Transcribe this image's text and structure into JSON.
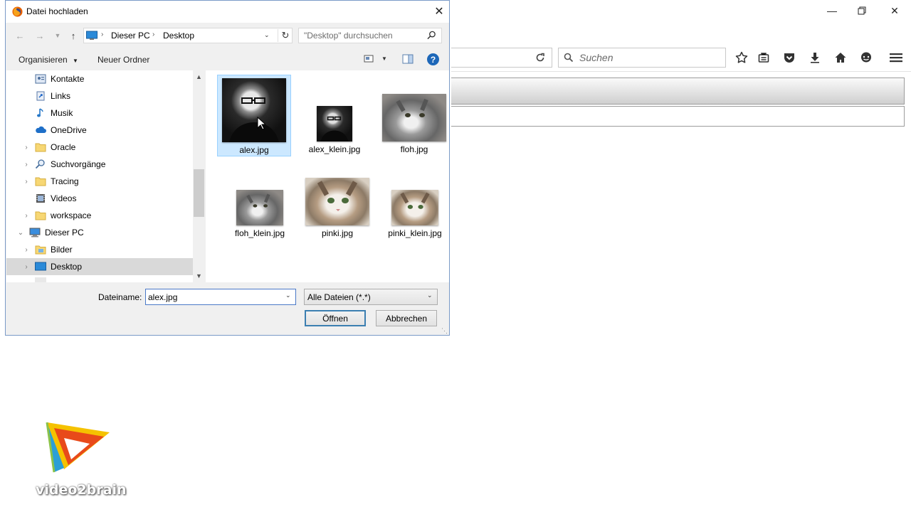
{
  "browser": {
    "search_placeholder": "Suchen",
    "window_controls": [
      "minimize-icon",
      "restore-icon",
      "close-icon"
    ],
    "toolbar_icons": [
      "reload-icon",
      "search-icon",
      "bookmark-star-icon",
      "reading-list-icon",
      "pocket-icon",
      "download-icon",
      "home-icon",
      "chat-icon",
      "menu-icon"
    ]
  },
  "dialog": {
    "title": "Datei hochladen",
    "breadcrumb": [
      "Dieser PC",
      "Desktop"
    ],
    "search_placeholder": "\"Desktop\" durchsuchen",
    "commands": {
      "organize": "Organisieren",
      "new_folder": "Neuer Ordner"
    },
    "nav_items": [
      {
        "label": "Kontakte",
        "icon": "contacts-icon",
        "chevron": false
      },
      {
        "label": "Links",
        "icon": "links-icon",
        "chevron": false
      },
      {
        "label": "Musik",
        "icon": "music-icon",
        "chevron": false
      },
      {
        "label": "OneDrive",
        "icon": "cloud-icon",
        "chevron": false
      },
      {
        "label": "Oracle",
        "icon": "folder-icon",
        "chevron": true
      },
      {
        "label": "Suchvorgänge",
        "icon": "search-icon",
        "chevron": true
      },
      {
        "label": "Tracing",
        "icon": "folder-icon",
        "chevron": true
      },
      {
        "label": "Videos",
        "icon": "video-icon",
        "chevron": false
      },
      {
        "label": "workspace",
        "icon": "folder-icon",
        "chevron": true
      },
      {
        "label": "Dieser PC",
        "icon": "computer-icon",
        "chevron": true,
        "expanded": true
      },
      {
        "label": "Bilder",
        "icon": "pictures-icon",
        "chevron": true
      },
      {
        "label": "Desktop",
        "icon": "desktop-icon",
        "chevron": true,
        "selected": true
      }
    ],
    "files": [
      {
        "name": "alex.jpg",
        "kind": "portrait",
        "selected": true
      },
      {
        "name": "alex_klein.jpg",
        "kind": "portrait"
      },
      {
        "name": "floh.jpg",
        "kind": "cat-grey"
      },
      {
        "name": "floh_klein.jpg",
        "kind": "cat-grey"
      },
      {
        "name": "pinki.jpg",
        "kind": "cat-tabby"
      },
      {
        "name": "pinki_klein.jpg",
        "kind": "cat-tabby"
      }
    ],
    "filename_label": "Dateiname:",
    "filename_value": "alex.jpg",
    "filter_value": "Alle Dateien (*.*)",
    "open_label": "Öffnen",
    "cancel_label": "Abbrechen"
  },
  "logo": {
    "text": "video2brain",
    "colors": [
      "#f5c200",
      "#e84a1a",
      "#2b9fd6",
      "#8bc34a"
    ]
  }
}
